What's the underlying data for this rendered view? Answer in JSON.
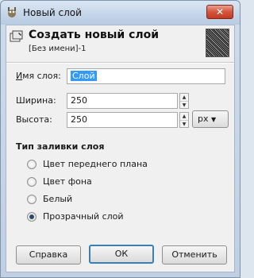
{
  "window": {
    "title": "Новый слой",
    "close_label": "✕"
  },
  "header": {
    "title": "Создать новый слой",
    "subtitle": "[Без имени]-1"
  },
  "form": {
    "name_label": "Имя слоя:",
    "name_value": "Слой",
    "width_label": "Ширина:",
    "width_value": "250",
    "height_label": "Высота:",
    "height_value": "250",
    "unit_value": "px"
  },
  "fill": {
    "title": "Тип заливки слоя",
    "options": [
      "Цвет переднего плана",
      "Цвет фона",
      "Белый",
      "Прозрачный слой"
    ],
    "selected_index": 3
  },
  "buttons": {
    "help": "Справка",
    "ok": "ОК",
    "cancel": "Отменить"
  }
}
